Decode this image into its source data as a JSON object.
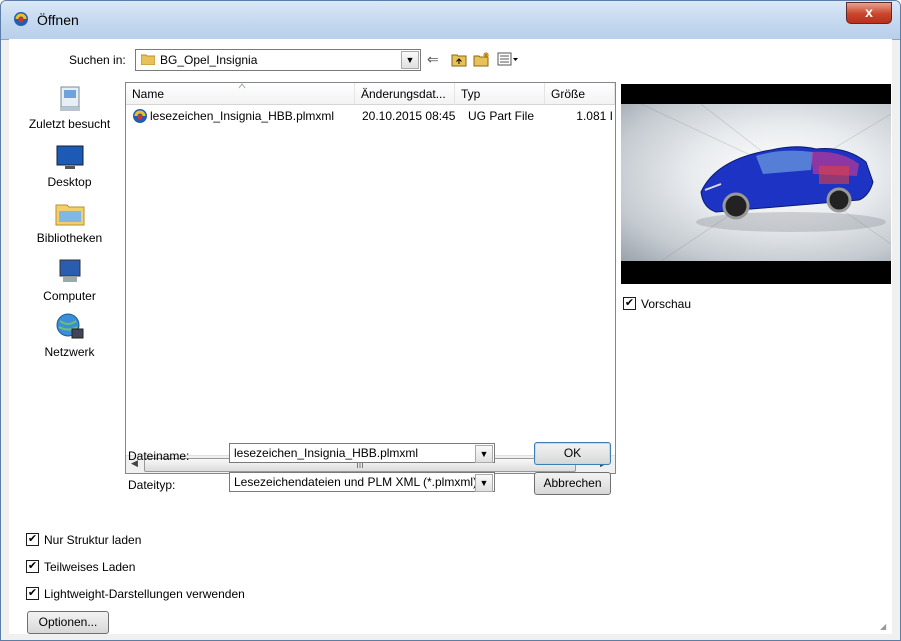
{
  "window": {
    "title": "Öffnen",
    "close_label": "x"
  },
  "lookin": {
    "label": "Suchen in:",
    "value": "BG_Opel_Insignia"
  },
  "toolbar": {
    "back_icon": "back-arrow-icon",
    "up_icon": "up-folder-icon",
    "newfolder_icon": "new-folder-icon",
    "views_icon": "view-menu-icon"
  },
  "places": [
    {
      "label": "Zuletzt besucht",
      "icon": "recent-places-icon"
    },
    {
      "label": "Desktop",
      "icon": "desktop-icon"
    },
    {
      "label": "Bibliotheken",
      "icon": "libraries-icon"
    },
    {
      "label": "Computer",
      "icon": "computer-icon"
    },
    {
      "label": "Netzwerk",
      "icon": "network-icon"
    }
  ],
  "filelist": {
    "columns": [
      "Name",
      "Änderungsdat...",
      "Typ",
      "Größe"
    ],
    "rows": [
      {
        "name": "lesezeichen_Insignia_HBB.plmxml",
        "date": "20.10.2015 08:45",
        "type": "UG Part File",
        "size": "1.081 I"
      }
    ],
    "scroll_thumb": "III"
  },
  "preview": {
    "checkbox_label": "Vorschau",
    "checked": true
  },
  "filename": {
    "label": "Dateiname:",
    "value": "lesezeichen_Insignia_HBB.plmxml"
  },
  "filetype": {
    "label": "Dateityp:",
    "value": "Lesezeichendateien und PLM XML (*.plmxml)"
  },
  "buttons": {
    "ok": "OK",
    "cancel": "Abbrechen",
    "options": "Optionen..."
  },
  "options": [
    {
      "label": "Nur Struktur laden",
      "checked": true
    },
    {
      "label": "Teilweises Laden",
      "checked": true
    },
    {
      "label": "Lightweight-Darstellungen verwenden",
      "checked": true
    }
  ]
}
